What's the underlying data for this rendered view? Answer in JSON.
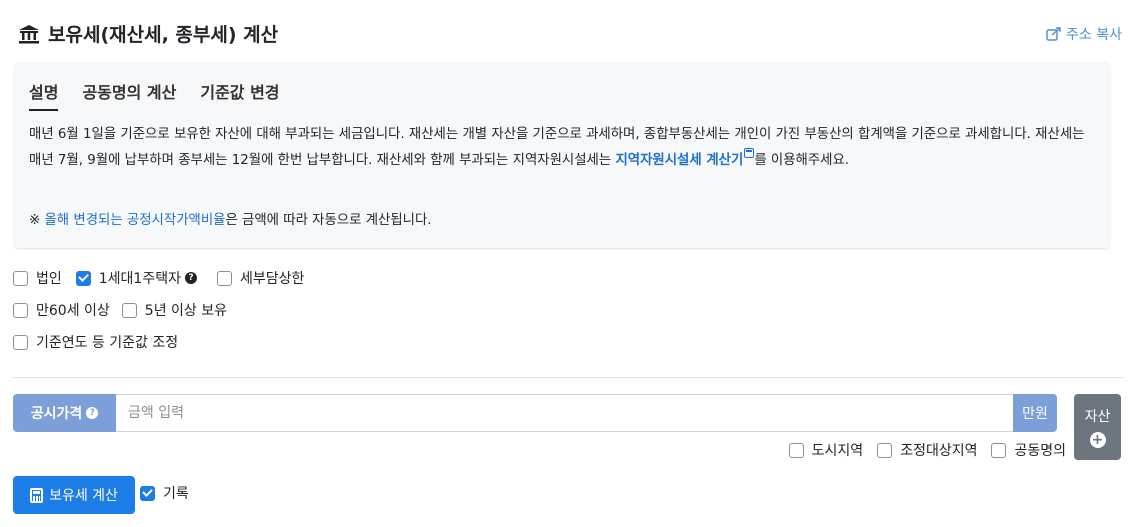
{
  "header": {
    "title": "보유세(재산세, 종부세) 계산",
    "title_icon": "bank-icon",
    "copy_label": "주소 복사",
    "copy_icon": "share-icon"
  },
  "tabs": [
    {
      "label": "설명",
      "active": true
    },
    {
      "label": "공동명의 계산",
      "active": false
    },
    {
      "label": "기준값 변경",
      "active": false
    }
  ],
  "description": {
    "text_1": "매년 6월 1일을 기준으로 보유한 자산에 대해 부과되는 세금입니다. 재산세는 개별 자산을 기준으로 과세하며, 종합부동산세는 개인이 가진 부동산의 합계액을 기준으로 과세합니다. 재산세는 매년 7월, 9월에 납부하며 종부세는 12월에 한번 납부합니다. 재산세와 함께 부과되는 지역자원시설세는 ",
    "link_text": "지역자원시설세 계산기",
    "text_2": "를 이용해주세요.",
    "note_prefix": "※ ",
    "note_link": "올해 변경되는 공정시작가액비율",
    "note_suffix": "은 금액에 따라 자동으로 계산됩니다."
  },
  "options": {
    "row1": [
      {
        "label": "법인",
        "checked": false
      },
      {
        "label": "1세대1주택자",
        "checked": true,
        "help": true
      },
      {
        "label": "세부담상한",
        "checked": false
      }
    ],
    "row2": [
      {
        "label": "만60세 이상",
        "checked": false
      },
      {
        "label": "5년 이상 보유",
        "checked": false
      }
    ],
    "row3": [
      {
        "label": "기준연도 등 기준값 조정",
        "checked": false
      }
    ]
  },
  "price_input": {
    "prefix_label": "공시가격",
    "placeholder": "금액 입력",
    "value": "",
    "suffix_label": "만원"
  },
  "asset_button": {
    "label": "자산",
    "icon": "plus-circle-icon"
  },
  "region_options": [
    {
      "label": "도시지역",
      "checked": false
    },
    {
      "label": "조정대상지역",
      "checked": false
    },
    {
      "label": "공동명의",
      "checked": false
    }
  ],
  "calc_button": {
    "label": "보유세 계산",
    "icon": "calculator-icon"
  },
  "record": {
    "label": "기록",
    "checked": true
  },
  "colors": {
    "primary": "#1d7de6",
    "input_addon": "#7c9fd9",
    "secondary": "#6c757d",
    "link": "#1d6fd1",
    "card_bg": "#f7f8fa"
  }
}
